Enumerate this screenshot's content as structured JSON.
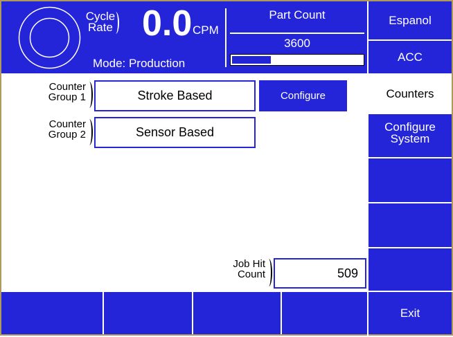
{
  "header": {
    "cycle_rate_line1": "Cycle",
    "cycle_rate_line2": "Rate",
    "rate_value": "0.0",
    "rate_unit": "CPM",
    "mode": "Mode: Production",
    "part_count_label": "Part Count",
    "part_count_value": "3600",
    "part_count_progress": 0.3
  },
  "side_menu": {
    "espanol": "Espanol",
    "acc": "ACC",
    "counters": "Counters",
    "configure_system_line1": "Configure",
    "configure_system_line2": "System"
  },
  "counters": {
    "group1_label_line1": "Counter",
    "group1_label_line2": "Group 1",
    "group1_value": "Stroke Based",
    "configure_button": "Configure",
    "group2_label_line1": "Counter",
    "group2_label_line2": "Group 2",
    "group2_value": "Sensor Based",
    "job_hit_label_line1": "Job Hit",
    "job_hit_label_line2": "Count",
    "job_hit_value": "509"
  },
  "footer": {
    "exit": "Exit"
  },
  "colors": {
    "accent_blue": "#2424d8",
    "frame": "#b09a5a"
  }
}
